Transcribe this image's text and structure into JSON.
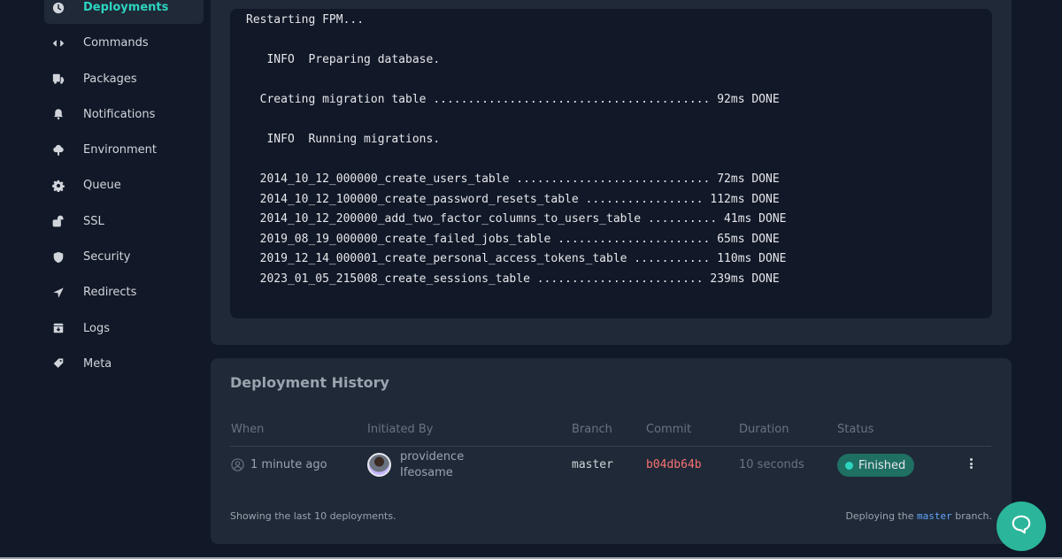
{
  "sidebar": {
    "items": [
      {
        "label": "Deployments",
        "icon": "clock-icon",
        "active": true
      },
      {
        "label": "Commands",
        "icon": "code-icon"
      },
      {
        "label": "Packages",
        "icon": "truck-icon"
      },
      {
        "label": "Notifications",
        "icon": "bell-icon"
      },
      {
        "label": "Environment",
        "icon": "tree-icon"
      },
      {
        "label": "Queue",
        "icon": "gear-icon"
      },
      {
        "label": "SSL",
        "icon": "unlock-icon"
      },
      {
        "label": "Security",
        "icon": "shield-icon"
      },
      {
        "label": "Redirects",
        "icon": "location-arrow-icon"
      },
      {
        "label": "Logs",
        "icon": "archive-icon"
      },
      {
        "label": "Meta",
        "icon": "tag-icon"
      }
    ]
  },
  "output": {
    "lines": [
      "Restarting FPM...",
      "",
      "   INFO  Preparing database.",
      "",
      "  Creating migration table ........................................ 92ms DONE",
      "",
      "   INFO  Running migrations.",
      "",
      "  2014_10_12_000000_create_users_table ............................ 72ms DONE",
      "  2014_10_12_100000_create_password_resets_table ................. 112ms DONE",
      "  2014_10_12_200000_add_two_factor_columns_to_users_table .......... 41ms DONE",
      "  2019_08_19_000000_create_failed_jobs_table ...................... 65ms DONE",
      "  2019_12_14_000001_create_personal_access_tokens_table ........... 110ms DONE",
      "  2023_01_05_215008_create_sessions_table ........................ 239ms DONE"
    ]
  },
  "history": {
    "title": "Deployment History",
    "columns": [
      "When",
      "Initiated By",
      "Branch",
      "Commit",
      "Duration",
      "Status"
    ],
    "rows": [
      {
        "when": "1 minute ago",
        "initiated_by_first": "providence",
        "initiated_by_last": "Ifeosame",
        "branch": "master",
        "commit": "b04db64b",
        "duration": "10 seconds",
        "status": "Finished"
      }
    ],
    "footer_left": "Showing the last 10 deployments.",
    "footer_right_prefix": "Deploying the",
    "footer_right_branch": "master",
    "footer_right_suffix": "branch."
  },
  "colors": {
    "accent": "#2dd4bf",
    "commit": "#f87171",
    "chat_button": "#2bb59a"
  }
}
